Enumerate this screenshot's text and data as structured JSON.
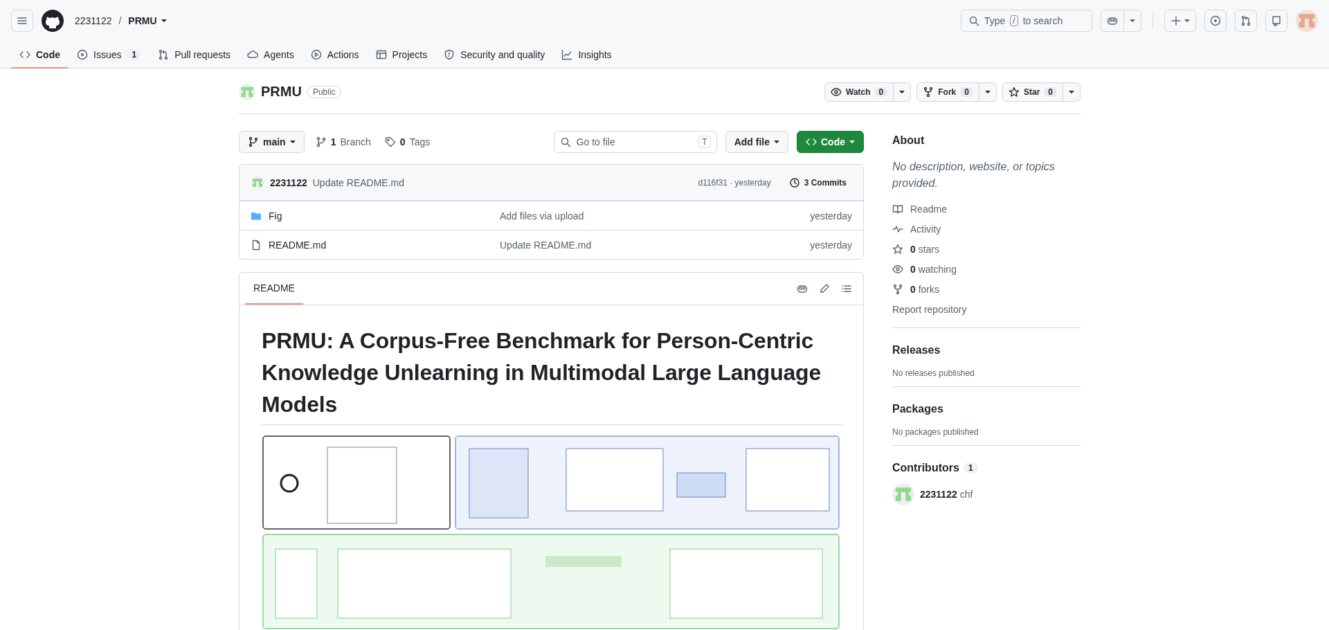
{
  "header": {
    "owner": "2231122",
    "separator": "/",
    "repo": "PRMU",
    "search": {
      "before": "Type",
      "key": "/",
      "after": "to search"
    }
  },
  "tabs": [
    {
      "kind": "code",
      "label": "Code",
      "selected": true
    },
    {
      "kind": "issues",
      "label": "Issues",
      "count": "1",
      "selected": false
    },
    {
      "kind": "pulls",
      "label": "Pull requests",
      "selected": false
    },
    {
      "kind": "agents",
      "label": "Agents",
      "selected": false
    },
    {
      "kind": "actions",
      "label": "Actions",
      "selected": false
    },
    {
      "kind": "projects",
      "label": "Projects",
      "selected": false
    },
    {
      "kind": "security",
      "label": "Security and quality",
      "selected": false
    },
    {
      "kind": "insights",
      "label": "Insights",
      "selected": false
    }
  ],
  "repo": {
    "name": "PRMU",
    "visibility": "Public",
    "actions": [
      {
        "kind": "watch",
        "label": "Watch",
        "count": "0"
      },
      {
        "kind": "fork",
        "label": "Fork",
        "count": "0"
      },
      {
        "kind": "star",
        "label": "Star",
        "count": "0"
      }
    ]
  },
  "toolbar": {
    "branch": "main",
    "branches": {
      "count": "1",
      "label": "Branch"
    },
    "tags": {
      "count": "0",
      "label": "Tags"
    },
    "file_search": {
      "placeholder": "Go to file",
      "key": "T"
    },
    "add_file": "Add file",
    "code": "Code"
  },
  "commit": {
    "author": "2231122",
    "message": "Update README.md",
    "sha_time": "d116f31 · yesterday",
    "commits": "3 Commits"
  },
  "files": [
    {
      "kind": "folder",
      "name": "Fig",
      "message": "Add files via upload",
      "time": "yesterday"
    },
    {
      "kind": "file",
      "name": "README.md",
      "message": "Update README.md",
      "time": "yesterday"
    }
  ],
  "readme": {
    "tab": "README",
    "title": "PRMU: A Corpus-Free Benchmark for Person-Centric Knowledge Unlearning in Multimodal Large Language Models"
  },
  "about": {
    "heading": "About",
    "description": "No description, website, or topics provided.",
    "links": [
      {
        "kind": "readme",
        "label": "Readme"
      },
      {
        "kind": "activity",
        "label": "Activity"
      },
      {
        "kind": "stars",
        "count": "0",
        "label": "stars"
      },
      {
        "kind": "watching",
        "count": "0",
        "label": "watching"
      },
      {
        "kind": "forks",
        "count": "0",
        "label": "forks"
      }
    ],
    "report": "Report repository"
  },
  "sections": [
    {
      "heading": "Releases",
      "text": "No releases published"
    },
    {
      "heading": "Packages",
      "text": "No packages published"
    }
  ],
  "contributors": {
    "heading": "Contributors",
    "count": "1",
    "people": [
      {
        "login": "2231122",
        "name": "chf"
      }
    ]
  }
}
